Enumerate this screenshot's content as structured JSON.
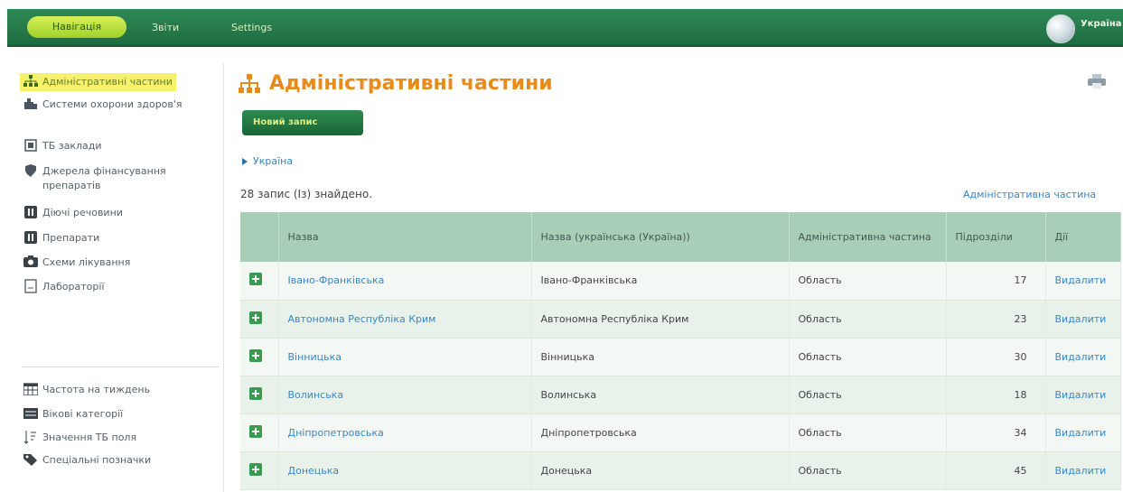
{
  "nav": {
    "tabs": [
      "Навігація",
      "Звіти",
      "Settings"
    ],
    "active_color": "#b9e64a",
    "user": "Україна"
  },
  "sidebar": {
    "items": [
      {
        "label": "Адміністративні частини",
        "icon": "org-chart-icon",
        "active": true
      },
      {
        "label": "Системи охорони здоров'я",
        "icon": "health-system-icon"
      },
      {
        "label": "ТБ заклади",
        "icon": "building-icon"
      },
      {
        "label": "Джерела фінансування препаратів",
        "icon": "funding-source-icon"
      },
      {
        "label": "Діючі речовини",
        "icon": "substance-icon"
      },
      {
        "label": "Препарати",
        "icon": "drug-icon"
      },
      {
        "label": "Схеми лікування",
        "icon": "regimen-icon"
      },
      {
        "label": "Лабораторії",
        "icon": "laboratory-icon"
      },
      {
        "label": "Частота на тиждень",
        "icon": "calendar-icon"
      },
      {
        "label": "Вікові категорії",
        "icon": "age-category-icon"
      },
      {
        "label": "Значення ТБ поля",
        "icon": "field-values-icon"
      },
      {
        "label": "Спеціальні позначки",
        "icon": "tag-icon"
      }
    ]
  },
  "main": {
    "title": "Адміністративні частини",
    "new_button": "Новий запис",
    "breadcrumb": "Україна",
    "count_text": "28 запис (Із) знайдено.",
    "right_link": "Адміністративна частина",
    "columns": [
      "Назва",
      "Назва (українська (Україна))",
      "Адміністративна частина",
      "Підрозділи",
      "Дії"
    ],
    "rows": [
      {
        "name": "Івано-Франківська",
        "name_uk": "Івано-Франківська",
        "type": "Область",
        "count": "17",
        "action": "Видалити"
      },
      {
        "name": "Автономна Республіка Крим",
        "name_uk": "Автономна Республіка Крим",
        "type": "Область",
        "count": "23",
        "action": "Видалити"
      },
      {
        "name": "Вінницька",
        "name_uk": "Вінницька",
        "type": "Область",
        "count": "30",
        "action": "Видалити"
      },
      {
        "name": "Волинська",
        "name_uk": "Волинська",
        "type": "Область",
        "count": "18",
        "action": "Видалити"
      },
      {
        "name": "Дніпропетровська",
        "name_uk": "Дніпропетровська",
        "type": "Область",
        "count": "34",
        "action": "Видалити"
      },
      {
        "name": "Донецька",
        "name_uk": "Донецька",
        "type": "Область",
        "count": "45",
        "action": "Видалити"
      }
    ]
  }
}
